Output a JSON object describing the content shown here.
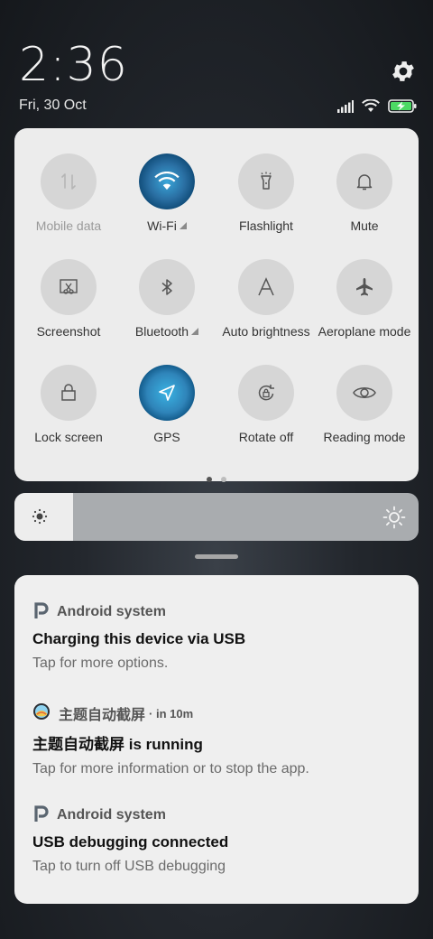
{
  "status": {
    "time": "2:36",
    "date": "Fri, 30 Oct",
    "icons": [
      "signal-icon",
      "wifi-icon",
      "battery-charging-icon"
    ]
  },
  "quick_settings": {
    "tiles": [
      {
        "label": "Mobile data",
        "icon": "mobile-data-icon",
        "active": false,
        "disabled": true
      },
      {
        "label": "Wi-Fi",
        "icon": "wifi-icon",
        "active": true,
        "expandable": true
      },
      {
        "label": "Flashlight",
        "icon": "flashlight-icon",
        "active": false
      },
      {
        "label": "Mute",
        "icon": "bell-icon",
        "active": false
      },
      {
        "label": "Screenshot",
        "icon": "screenshot-icon",
        "active": false
      },
      {
        "label": "Bluetooth",
        "icon": "bluetooth-icon",
        "active": false,
        "expandable": true
      },
      {
        "label": "Auto brightness",
        "icon": "auto-brightness-icon",
        "active": false
      },
      {
        "label": "Aeroplane mode",
        "icon": "airplane-icon",
        "active": false
      },
      {
        "label": "Lock screen",
        "icon": "lock-icon",
        "active": false
      },
      {
        "label": "GPS",
        "icon": "gps-icon",
        "active": true
      },
      {
        "label": "Rotate off",
        "icon": "rotate-lock-icon",
        "active": false
      },
      {
        "label": "Reading mode",
        "icon": "eye-icon",
        "active": false
      }
    ],
    "page_count": 2,
    "current_page": 1
  },
  "brightness": {
    "level": 0.145
  },
  "notifications": [
    {
      "app": "Android system",
      "time": "",
      "title": "Charging this device via USB",
      "body": "Tap for more options.",
      "icon": "android-system-icon"
    },
    {
      "app": "主题自动截屏",
      "time": "· in 10m",
      "title": "主题自动截屏 is running",
      "body": "Tap for more information or to stop the app.",
      "icon": "app-theme-icon"
    },
    {
      "app": "Android system",
      "time": "",
      "title": "USB debugging connected",
      "body": "Tap to turn off USB debugging",
      "icon": "android-system-icon"
    }
  ]
}
